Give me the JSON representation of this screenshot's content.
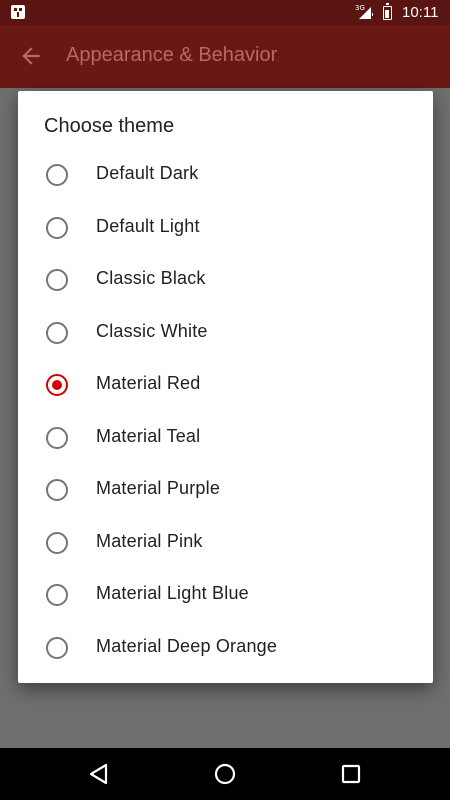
{
  "status_bar": {
    "network_tag": "3G",
    "time": "10:11",
    "icons": [
      "notification-icon",
      "signal-icon",
      "battery-icon"
    ]
  },
  "app_bar": {
    "title": "Appearance & Behavior",
    "back_icon": "arrow-back-icon"
  },
  "dialog": {
    "title": "Choose theme",
    "accent_color": "#d50000",
    "options": [
      {
        "label": "Default Dark",
        "selected": false
      },
      {
        "label": "Default Light",
        "selected": false
      },
      {
        "label": "Classic Black",
        "selected": false
      },
      {
        "label": "Classic White",
        "selected": false
      },
      {
        "label": "Material Red",
        "selected": true
      },
      {
        "label": "Material Teal",
        "selected": false
      },
      {
        "label": "Material Purple",
        "selected": false
      },
      {
        "label": "Material Pink",
        "selected": false
      },
      {
        "label": "Material Light Blue",
        "selected": false
      },
      {
        "label": "Material Deep Orange",
        "selected": false
      }
    ]
  },
  "nav_bar": {
    "buttons": [
      "back-triangle-icon",
      "home-circle-icon",
      "recents-square-icon"
    ]
  }
}
